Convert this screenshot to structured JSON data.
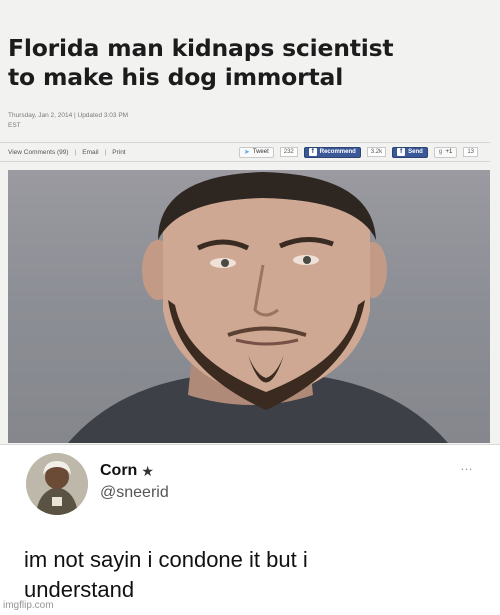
{
  "article": {
    "headline_line1": "Florida man kidnaps scientist",
    "headline_line2": "to make his dog immortal",
    "meta_line1": "Thursday, Jan 2, 2014 | Updated 3:03 PM",
    "meta_line2": "EST",
    "toolbar": {
      "view_comments": "View Comments (99)",
      "email": "Email",
      "print": "Print",
      "tweet_label": "Tweet",
      "tweet_count": "232",
      "recommend_label": "Recommend",
      "recommend_count": "3.2k",
      "send_label": "Send",
      "gplus_label": "+1",
      "gplus_count": "13"
    }
  },
  "tweet": {
    "display_name": "Corn",
    "handle": "@sneerid",
    "text_line1": "im not sayin i condone it but i",
    "text_line2": "understand",
    "more_icon": "…"
  },
  "watermark": "imgflip.com"
}
